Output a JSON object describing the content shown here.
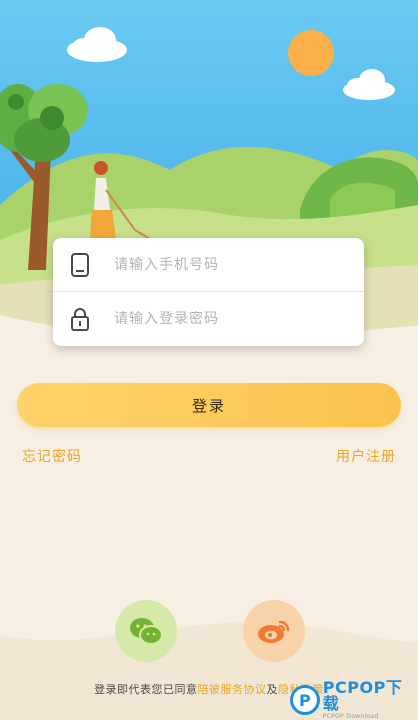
{
  "login_form": {
    "phone_placeholder": "请输入手机号码",
    "password_placeholder": "请输入登录密码",
    "phone_icon": "phone-icon",
    "lock_icon": "lock-icon"
  },
  "actions": {
    "login_label": "登录",
    "forgot_password": "忘记密码",
    "register": "用户注册"
  },
  "social_login": [
    {
      "name": "wechat",
      "icon": "wechat-icon"
    },
    {
      "name": "weibo",
      "icon": "weibo-icon"
    }
  ],
  "agreement": {
    "prefix": "登录即代表您已同意",
    "service_agreement": "陪彼服务协议",
    "and": "及",
    "privacy_policy": "隐私政策"
  },
  "watermark": {
    "brand": "PCPOP下载",
    "subtitle": "PCPOP Download"
  },
  "colors": {
    "accent": "#fbc24e",
    "link": "#e6a723",
    "sky": "#5ec3ef",
    "background": "#f7efe3"
  }
}
